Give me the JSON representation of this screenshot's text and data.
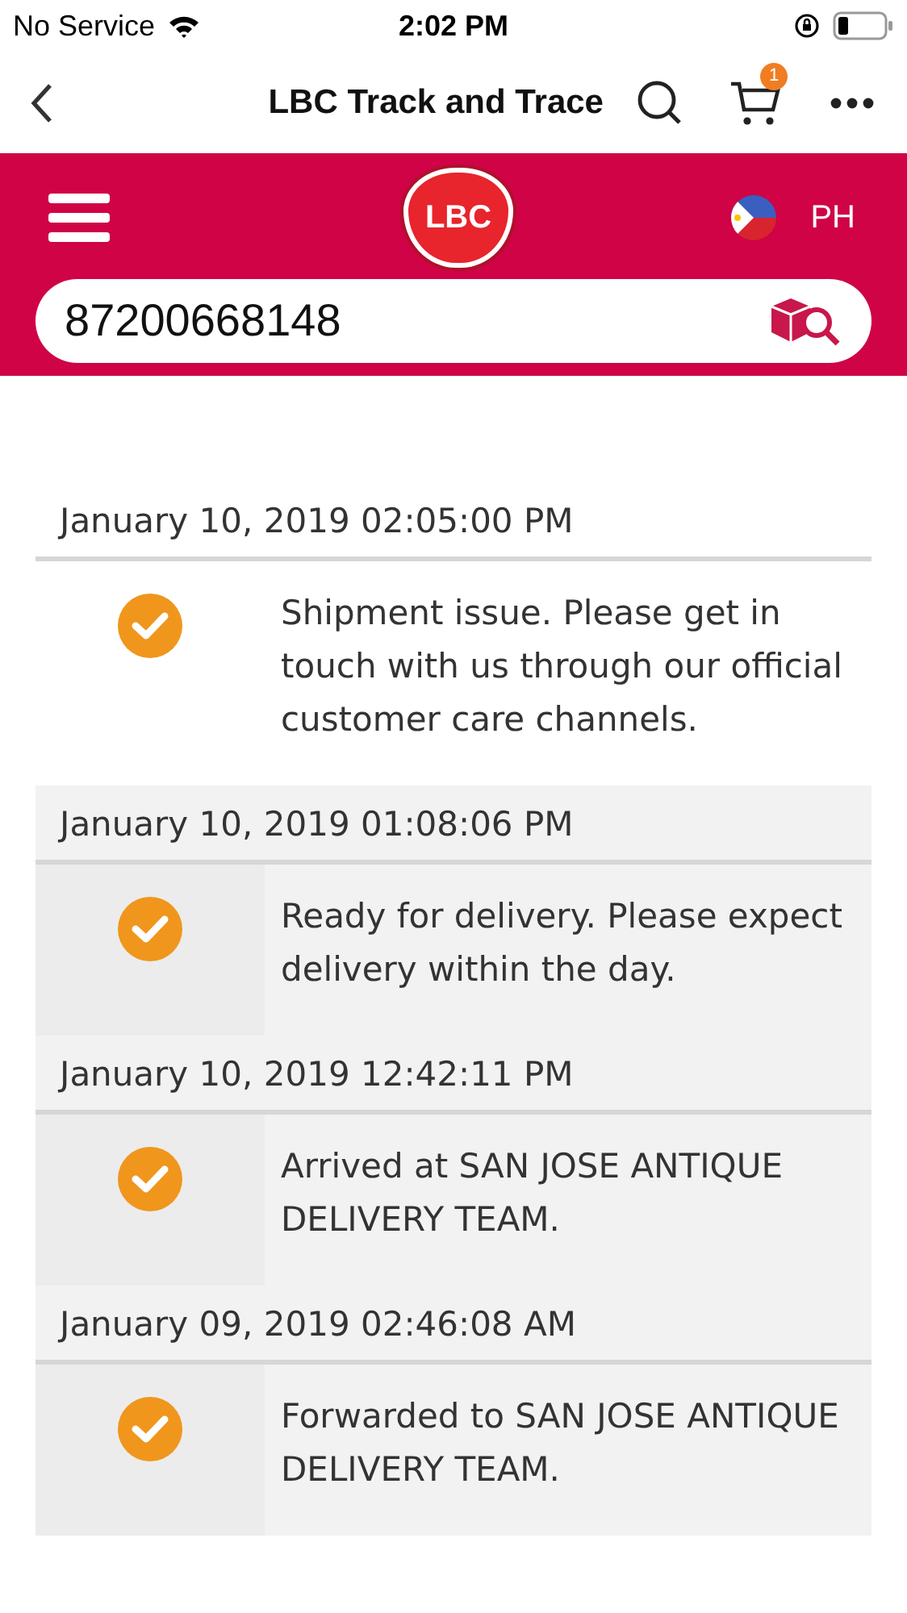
{
  "status_bar": {
    "carrier": "No Service",
    "time": "2:02 PM"
  },
  "nav_bar": {
    "title": "LBC Track and Trace",
    "cart_badge": "1"
  },
  "header": {
    "logo": "LBC",
    "country": "PH"
  },
  "search": {
    "value": "87200668148"
  },
  "events": [
    {
      "date": "January 10, 2019 02:05:00 PM",
      "status": "Shipment issue. Please get in touch with us through our official customer care channels.",
      "latest": true
    },
    {
      "date": "January 10, 2019 01:08:06 PM",
      "status": "Ready for delivery. Please expect delivery within the day.",
      "latest": false
    },
    {
      "date": "January 10, 2019 12:42:11 PM",
      "status": "Arrived at SAN JOSE ANTIQUE DELIVERY TEAM.",
      "latest": false
    },
    {
      "date": "January 09, 2019 02:46:08 AM",
      "status": "Forwarded to SAN JOSE ANTIQUE DELIVERY TEAM.",
      "latest": false
    }
  ]
}
